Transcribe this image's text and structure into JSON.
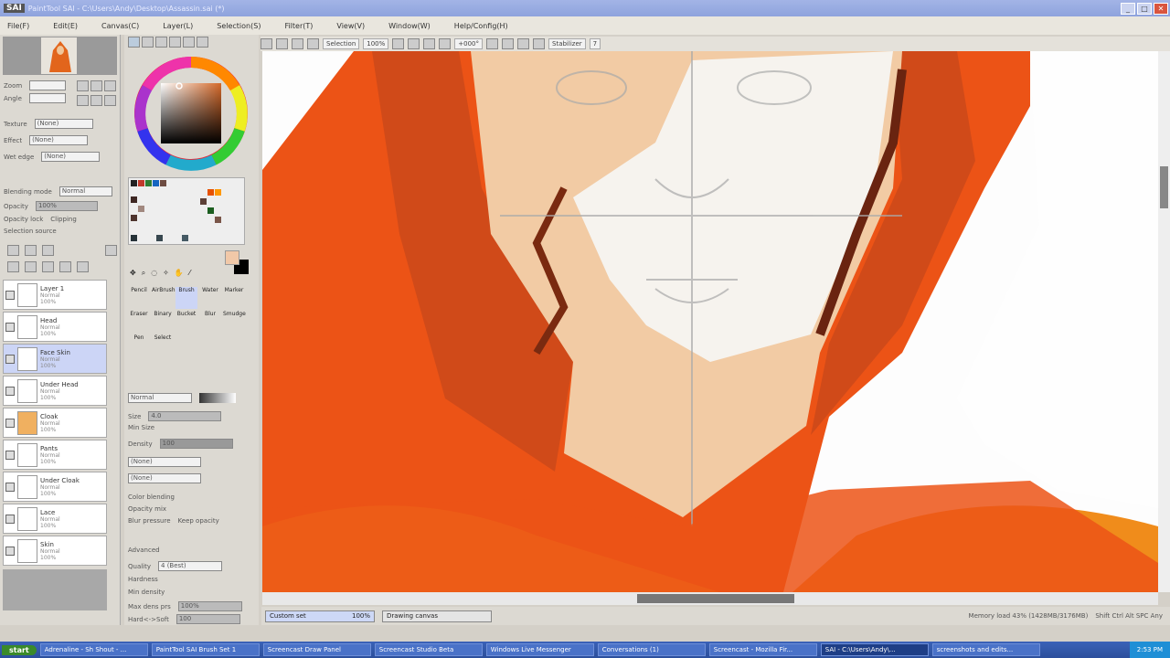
{
  "app": {
    "logo": "SAI",
    "title": "PaintTool SAI - C:\\Users\\Andy\\Desktop\\Assassin.sai (*)"
  },
  "menu": [
    "File(F)",
    "Edit(E)",
    "Canvas(C)",
    "Layer(L)",
    "Selection(S)",
    "Filter(T)",
    "View(V)",
    "Window(W)",
    "Help/Config(H)"
  ],
  "toolbar": {
    "selection_label": "Selection",
    "zoom": "100%",
    "angle": "+000°",
    "stabilizer_label": "Stabilizer",
    "stabilizer_value": "7"
  },
  "color_props": {
    "zoom_label": "Zoom",
    "angle_label": "Angle",
    "texture_label": "Texture",
    "texture_value": "(None)",
    "effect_label": "Effect",
    "effect_value": "(None)",
    "wet_edge_label": "Wet edge",
    "wet_edge_value": "(None)"
  },
  "layer_props": {
    "blending_label": "Blending mode",
    "blending_value": "Normal",
    "opacity_label": "Opacity",
    "opacity_value": "100%",
    "protect_label": "Opacity lock",
    "clipping_label": "Clipping",
    "selection_source": "Selection source"
  },
  "layers": [
    {
      "name": "Layer 1",
      "mode": "Normal",
      "opacity": "100%"
    },
    {
      "name": "Head",
      "mode": "Normal",
      "opacity": "100%"
    },
    {
      "name": "Face Skin",
      "mode": "Normal",
      "opacity": "100%",
      "active": true
    },
    {
      "name": "Under Head",
      "mode": "Normal",
      "opacity": "100%"
    },
    {
      "name": "Cloak",
      "mode": "Normal",
      "opacity": "100%"
    },
    {
      "name": "Pants",
      "mode": "Normal",
      "opacity": "100%"
    },
    {
      "name": "Under Cloak",
      "mode": "Normal",
      "opacity": "100%"
    },
    {
      "name": "Lace",
      "mode": "Normal",
      "opacity": "100%"
    },
    {
      "name": "Skin",
      "mode": "Normal",
      "opacity": "100%"
    }
  ],
  "tools": [
    "Pencil",
    "AirBrush",
    "Brush",
    "Water",
    "Marker",
    "Eraser",
    "Binary",
    "Bucket",
    "Blur",
    "Smudge",
    "Pen",
    "Select"
  ],
  "brush_props": {
    "mode": "Normal",
    "size_label": "Size",
    "size_value": "4.0",
    "min_size": "Min Size",
    "density": "Density",
    "density_value": "100",
    "shape1": "(None)",
    "shape2": "(None)",
    "color_blending": "Color blending",
    "opacity_mix": "Opacity mix",
    "blur_pressure": "Blur pressure",
    "keep_opacity": "Keep opacity",
    "advanced": "Advanced",
    "quality_label": "Quality",
    "quality_value": "4 (Best)",
    "hardness": "Hardness",
    "min_density": "Min density",
    "max_dens_prs": "Max dens prs",
    "hard_soft": "Hard<->Soft",
    "max_dens_value": "100%",
    "hs_value": "100"
  },
  "status": {
    "nav1": "Custom set",
    "nav1_value": "100%",
    "nav2": "Drawing canvas",
    "info": "Memory load 43% (1428MB/3176MB)",
    "keys": "Shift Ctrl Alt SPC Any"
  },
  "taskbar": {
    "start": "start",
    "items": [
      "Adrenaline - Sh Shout - ...",
      "PaintTool SAI Brush Set 1",
      "Screencast Draw Panel",
      "Screencast Studio Beta",
      "Windows Live Messenger",
      "Conversations (1)",
      "Screencast - Mozilla Fir...",
      "SAI - C:\\Users\\Andy\\...",
      "screenshots and edits..."
    ],
    "clock": "2:53 PM"
  }
}
